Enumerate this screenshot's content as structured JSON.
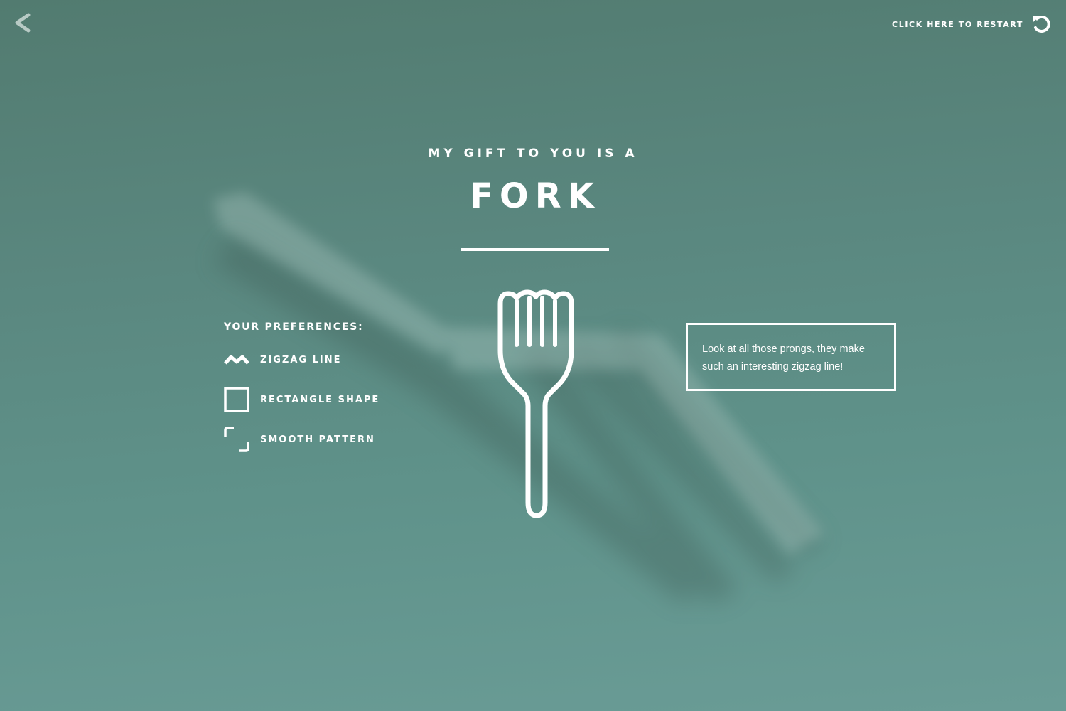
{
  "header": {
    "restart_label": "CLICK HERE TO RESTART"
  },
  "icons": {
    "back": "chevron-left-icon",
    "restart": "restart-icon",
    "fork": "fork-icon",
    "zigzag": "zigzag-icon",
    "rectangle": "rectangle-icon",
    "pattern": "corner-pattern-icon"
  },
  "result": {
    "subtitle": "MY GIFT TO YOU IS A",
    "title": "FORK"
  },
  "preferences": {
    "heading": "YOUR PREFERENCES:",
    "items": [
      {
        "label": "ZIGZAG LINE"
      },
      {
        "label": "RECTANGLE SHAPE"
      },
      {
        "label": "SMOOTH PATTERN"
      }
    ]
  },
  "note": {
    "text": "Look at all those prongs, they make such an interesting zigzag line!"
  },
  "colors": {
    "background": "#5a877f",
    "foreground": "#ffffff"
  }
}
